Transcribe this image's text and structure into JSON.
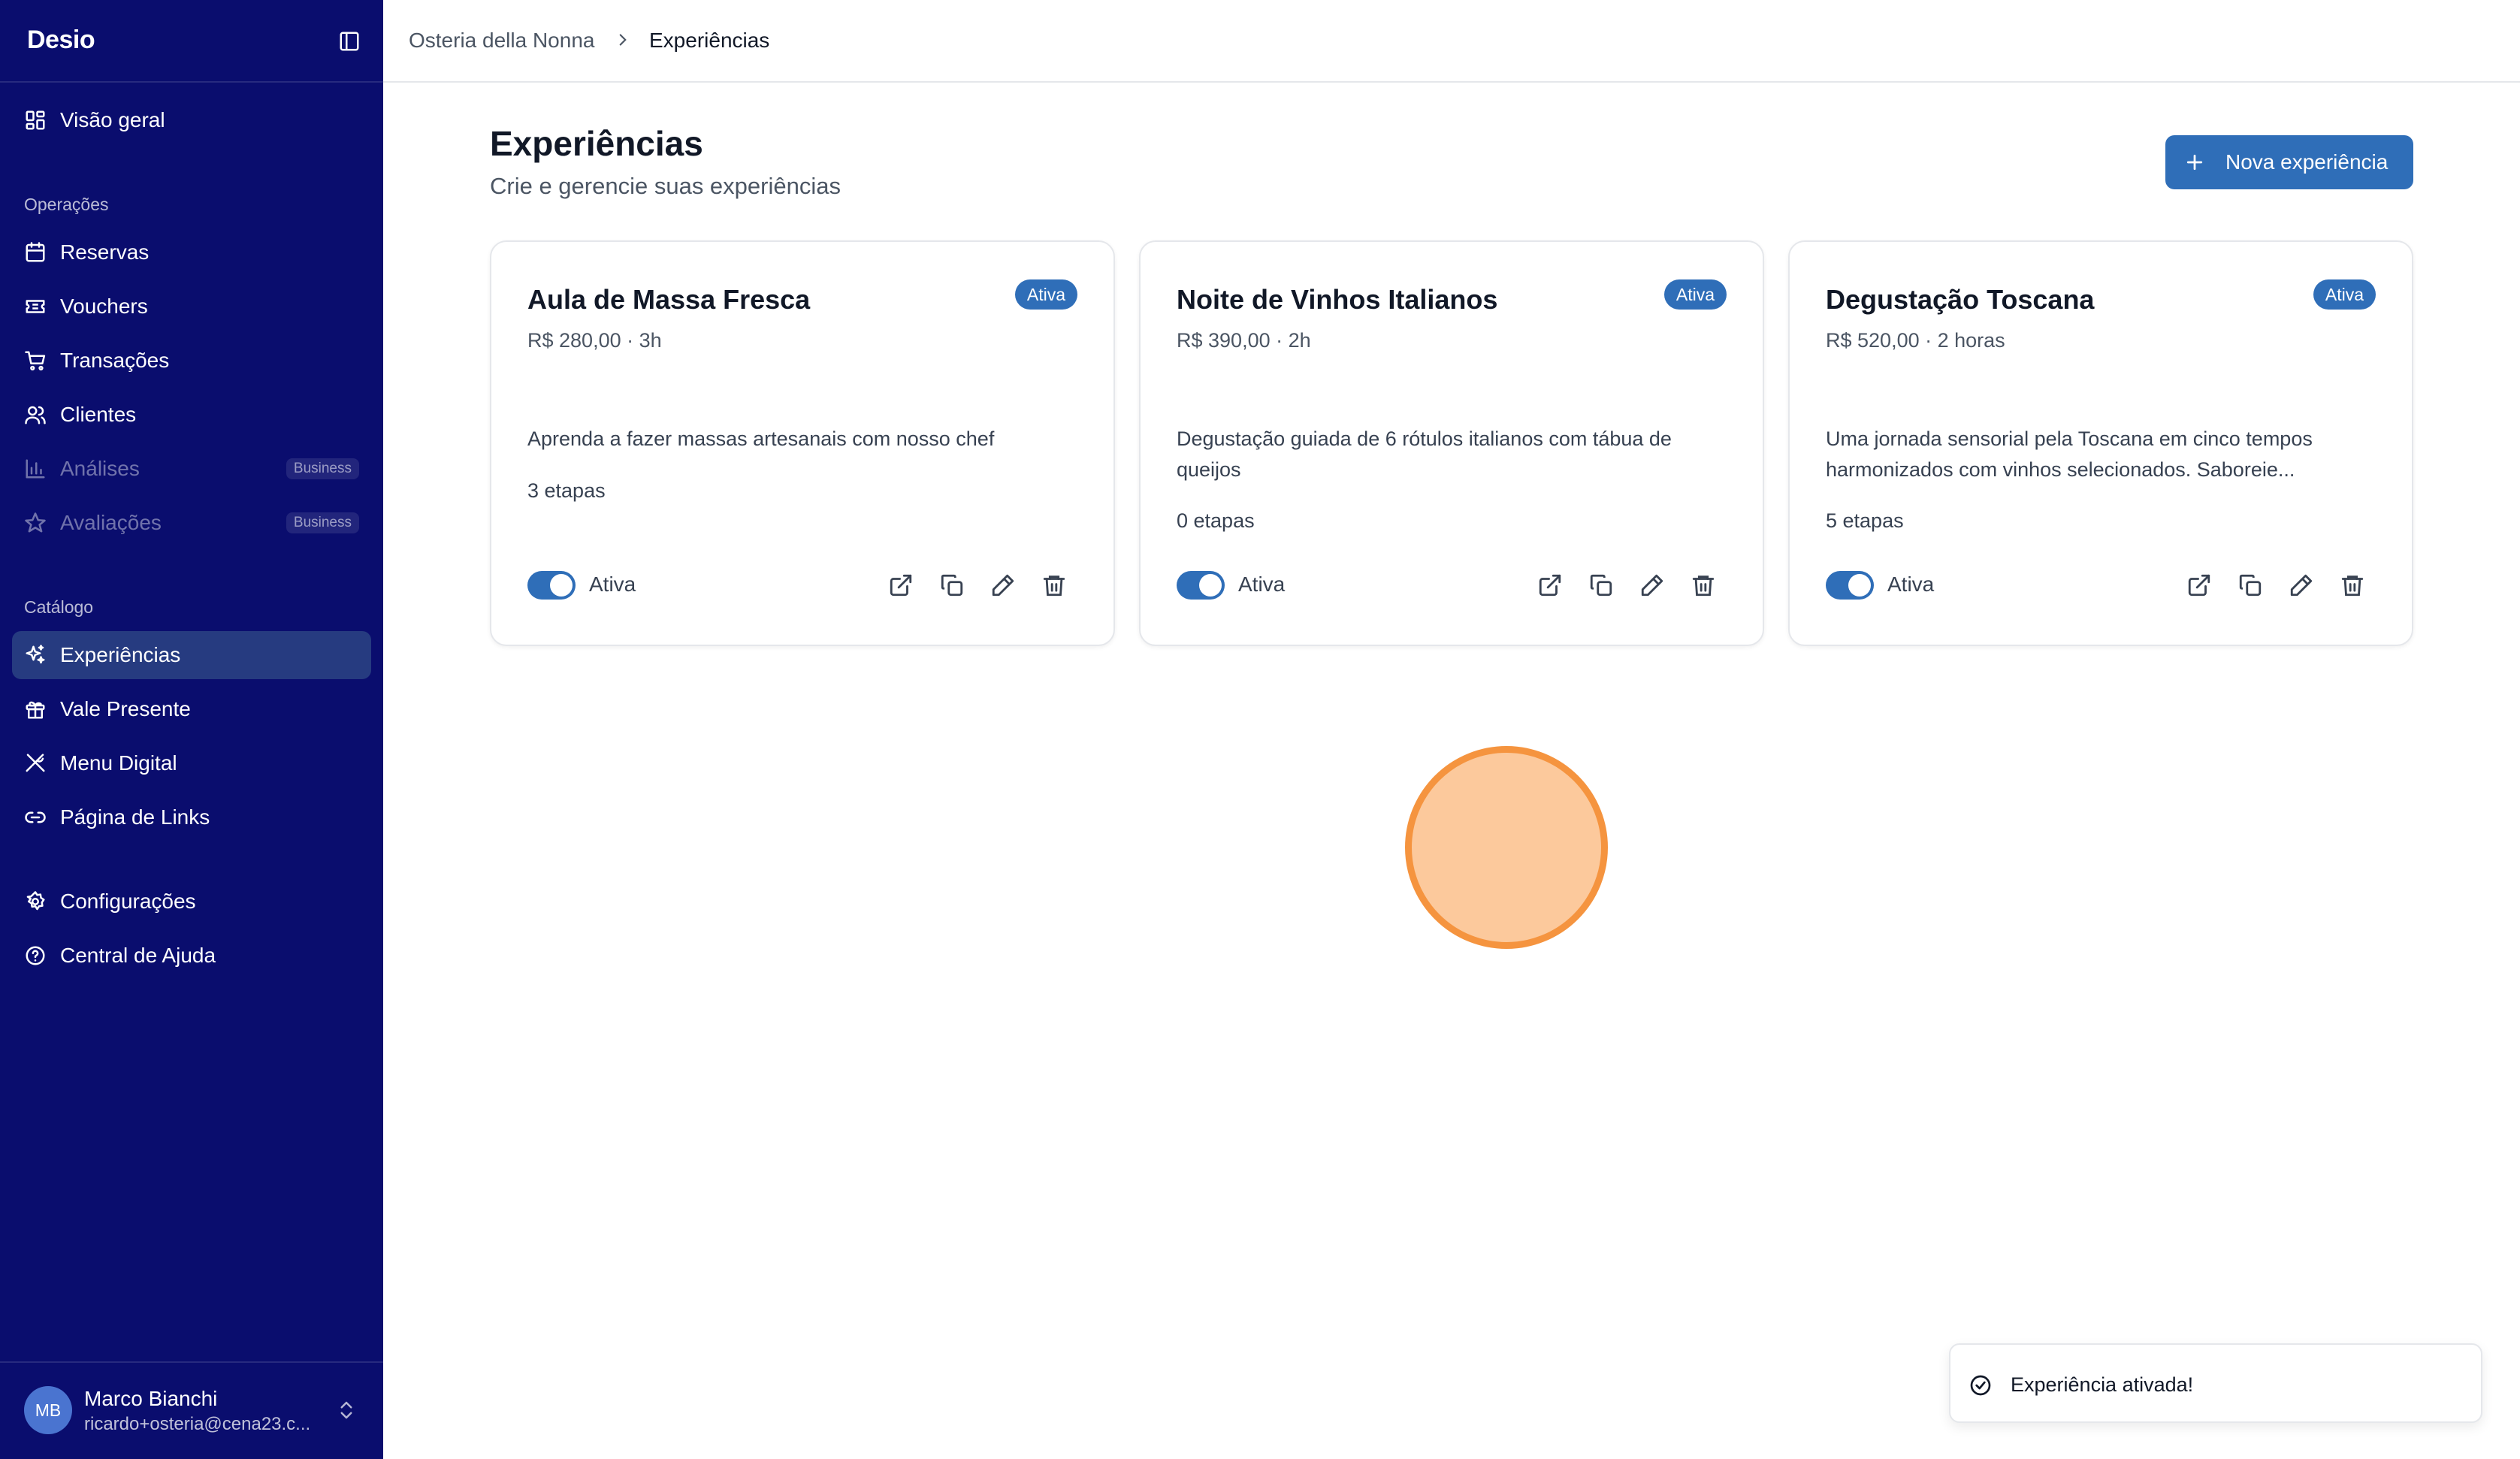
{
  "app": {
    "logo": "Desio"
  },
  "colors": {
    "sidebar_bg": "#0a0d6e",
    "accent": "#2f6eb8",
    "active_item": "#263b80",
    "cursor_fill": "#fcc99c",
    "cursor_ring": "#f5943f"
  },
  "sidebar": {
    "overview": {
      "label": "Visão geral",
      "icon": "grid-icon"
    },
    "sections": [
      {
        "title": "Operações"
      },
      {
        "title": "Catálogo"
      }
    ],
    "operations": [
      {
        "label": "Reservas",
        "icon": "calendar-icon"
      },
      {
        "label": "Vouchers",
        "icon": "ticket-icon"
      },
      {
        "label": "Transações",
        "icon": "cart-icon"
      },
      {
        "label": "Clientes",
        "icon": "users-icon"
      },
      {
        "label": "Análises",
        "icon": "bar-chart-icon",
        "badge": "Business",
        "disabled": true
      },
      {
        "label": "Avaliações",
        "icon": "star-icon",
        "badge": "Business",
        "disabled": true
      }
    ],
    "catalog": [
      {
        "label": "Experiências",
        "icon": "sparkles-icon",
        "active": true
      },
      {
        "label": "Vale Presente",
        "icon": "gift-icon"
      },
      {
        "label": "Menu Digital",
        "icon": "utensils-icon"
      },
      {
        "label": "Página de Links",
        "icon": "link-icon"
      }
    ],
    "bottom": [
      {
        "label": "Configurações",
        "icon": "gear-icon"
      },
      {
        "label": "Central de Ajuda",
        "icon": "help-circle-icon"
      }
    ],
    "user": {
      "initials": "MB",
      "name": "Marco Bianchi",
      "email": "ricardo+osteria@cena23.c..."
    }
  },
  "breadcrumb": {
    "restaurant": "Osteria della Nonna",
    "current": "Experiências"
  },
  "page": {
    "title": "Experiências",
    "subtitle": "Crie e gerencie suas experiências",
    "new_button": "Nova experiência"
  },
  "experiences": [
    {
      "title": "Aula de Massa Fresca",
      "meta": "R$ 280,00 · 3h",
      "status": "Ativa",
      "description": "Aprenda a fazer massas artesanais com nosso chef",
      "steps": "3 etapas",
      "toggle_label": "Ativa",
      "enabled": true
    },
    {
      "title": "Noite de Vinhos Italianos",
      "meta": "R$ 390,00 · 2h",
      "status": "Ativa",
      "description": "Degustação guiada de 6 rótulos italianos com tábua de queijos",
      "steps": "0 etapas",
      "toggle_label": "Ativa",
      "enabled": true
    },
    {
      "title": "Degustação Toscana",
      "meta": "R$ 520,00 · 2 horas",
      "status": "Ativa",
      "description": "Uma jornada sensorial pela Toscana em cinco tempos harmonizados com vinhos selecionados. Saboreie...",
      "steps": "5 etapas",
      "toggle_label": "Ativa",
      "enabled": true
    }
  ],
  "toast": {
    "message": "Experiência ativada!",
    "icon": "check-circle-icon"
  }
}
